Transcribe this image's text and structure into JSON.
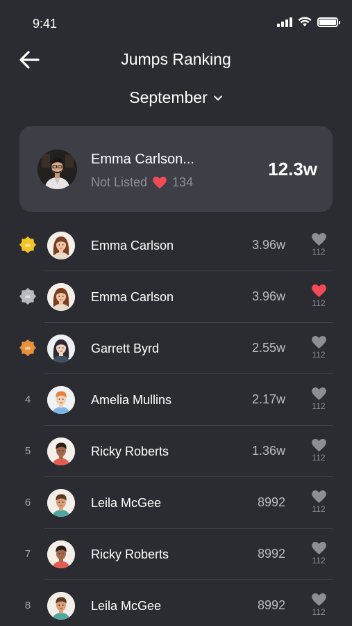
{
  "status_bar": {
    "time": "9:41"
  },
  "header": {
    "title": "Jumps Ranking"
  },
  "month_selector": {
    "label": "September"
  },
  "my_card": {
    "name": "Emma Carlson...",
    "status": "Not Listed",
    "likes": "134",
    "score": "12.3w"
  },
  "ranking": [
    {
      "rank": "1",
      "badge": "gold",
      "name": "Emma Carlson",
      "score": "3.96w",
      "likes": "112",
      "liked": false,
      "avatar": "woman-brown-hair"
    },
    {
      "rank": "2",
      "badge": "silver",
      "name": "Emma Carlson",
      "score": "3.96w",
      "likes": "112",
      "liked": true,
      "avatar": "woman-brown-hair"
    },
    {
      "rank": "3",
      "badge": "bronze",
      "name": "Garrett Byrd",
      "score": "2.55w",
      "likes": "112",
      "liked": false,
      "avatar": "woman-dark-hair"
    },
    {
      "rank": "4",
      "badge": "",
      "name": "Amelia Mullins",
      "score": "2.17w",
      "likes": "112",
      "liked": false,
      "avatar": "man-ginger-blue-shirt"
    },
    {
      "rank": "5",
      "badge": "",
      "name": "Ricky Roberts",
      "score": "1.36w",
      "likes": "112",
      "liked": false,
      "avatar": "man-dark-red-shirt"
    },
    {
      "rank": "6",
      "badge": "",
      "name": "Leila McGee",
      "score": "8992",
      "likes": "112",
      "liked": false,
      "avatar": "man-brown-teal-shirt"
    },
    {
      "rank": "7",
      "badge": "",
      "name": "Ricky Roberts",
      "score": "8992",
      "likes": "112",
      "liked": false,
      "avatar": "man-dark-red-shirt"
    },
    {
      "rank": "8",
      "badge": "",
      "name": "Leila McGee",
      "score": "8992",
      "likes": "112",
      "liked": false,
      "avatar": "man-brown-teal-shirt"
    }
  ],
  "colors": {
    "background": "#2b2c31",
    "card": "#3d3e46",
    "heart_active": "#f04b57",
    "heart_inactive": "#8c8d95",
    "gold": "#f2c526",
    "silver": "#b9babf",
    "bronze": "#e8913a"
  },
  "icons": {
    "back": "arrow-left-icon",
    "dropdown": "chevron-down-icon",
    "like": "heart-icon",
    "medal": "medal-icon",
    "signal": "signal-icon",
    "wifi": "wifi-icon",
    "battery": "battery-icon"
  }
}
